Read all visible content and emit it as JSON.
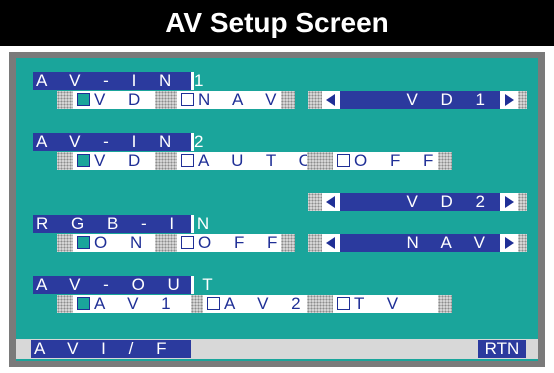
{
  "title": "AV Setup Screen",
  "sections": {
    "av_in1": {
      "label": "A V - I N 1",
      "options": [
        "V D",
        "N A V"
      ],
      "selected": "V D"
    },
    "av_in2": {
      "label": "A V - I N 2",
      "options": [
        "V D",
        "A U T O",
        "O F F"
      ],
      "selected": "V D"
    },
    "rgb_in": {
      "label": "R G B - I N",
      "options": [
        "O N",
        "O F F"
      ],
      "selected": "O N"
    },
    "av_out": {
      "label": "A V - O U T",
      "options": [
        "A V 1",
        "A V 2",
        "T   V"
      ],
      "selected": "A V 1"
    }
  },
  "selectors": {
    "vd1": "V D   1",
    "vd2": "V D   2",
    "nav": "N A V"
  },
  "footer": {
    "av_if": "A V   I / F",
    "rtn": "RTN"
  },
  "colors": {
    "title_bg": "#000000",
    "screen_bg": "#1aa59b",
    "label_bg": "#2b3a9e",
    "text_dark": "#1f2f96"
  }
}
